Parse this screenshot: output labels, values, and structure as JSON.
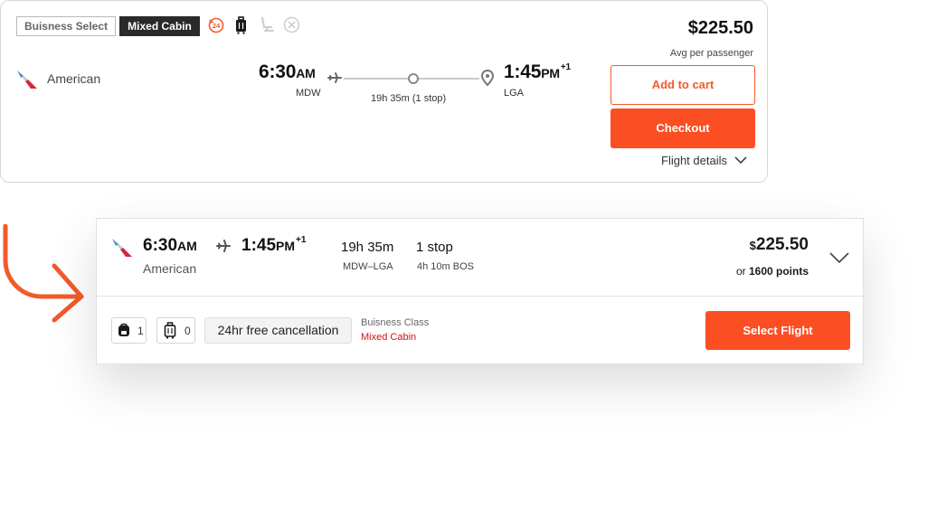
{
  "colors": {
    "accent": "#fc4e23",
    "dark_tag": "#2a2a2a",
    "mixed_red": "#d4121a"
  },
  "card_top": {
    "tags": [
      "Buisness Select",
      "Mixed Cabin"
    ],
    "amenity_icons": [
      "24h-cancellation-icon",
      "carry-on-bag-icon",
      "seat-icon",
      "no-change-icon"
    ],
    "airline": "American",
    "depart": {
      "time": "6:30",
      "ampm": "AM",
      "airport": "MDW"
    },
    "arrive": {
      "time": "1:45",
      "ampm": "PM",
      "day_offset": "+1",
      "airport": "LGA"
    },
    "duration": "19h 35m (1 stop)",
    "price": "$225.50",
    "price_note": "Avg per passenger",
    "add_to_cart": "Add to cart",
    "checkout": "Checkout",
    "flight_details": "Flight details"
  },
  "card_bottom": {
    "depart_time": "6:30",
    "depart_ampm": "AM",
    "arrive_time": "1:45",
    "arrive_ampm": "PM",
    "day_offset": "+1",
    "airline": "American",
    "duration": "19h 35m",
    "route": "MDW–LGA",
    "stops": "1 stop",
    "layover": "4h 10m BOS",
    "currency": "$",
    "price": "225.50",
    "or_text": "or",
    "points": "1600 points",
    "personal_item_count": "1",
    "carry_on_count": "0",
    "cancellation": "24hr free cancellation",
    "cabin_class": "Buisness Class",
    "mixed_cabin": "Mixed Cabin",
    "select_flight": "Select Flight"
  }
}
